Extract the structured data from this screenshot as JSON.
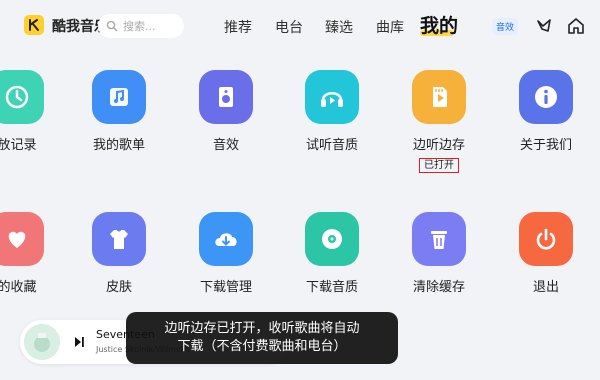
{
  "header": {
    "app_name": "酷我音乐",
    "search_placeholder": "搜索...",
    "nav": [
      "推荐",
      "电台",
      "臻选",
      "曲库"
    ],
    "active_nav": "我的",
    "sound_effect_label": "音效"
  },
  "grid": {
    "row1": [
      {
        "label": "放记录",
        "icon": "clock-icon",
        "color": "#3ed3b4"
      },
      {
        "label": "我的歌单",
        "icon": "music-note-icon",
        "color": "#3f8ff7"
      },
      {
        "label": "音效",
        "icon": "speaker-icon",
        "color": "#6b6ee9"
      },
      {
        "label": "试听音质",
        "icon": "headphones-icon",
        "color": "#22c6d8"
      },
      {
        "label": "边听边存",
        "icon": "sd-card-icon",
        "color": "#f5b13a",
        "status": "已打开"
      },
      {
        "label": "关于我们",
        "icon": "info-icon",
        "color": "#5b73e9"
      }
    ],
    "row2": [
      {
        "label": "的收藏",
        "icon": "heart-icon",
        "color": "#f07677"
      },
      {
        "label": "皮肤",
        "icon": "tshirt-icon",
        "color": "#6a7cf0"
      },
      {
        "label": "下载管理",
        "icon": "cloud-download-icon",
        "color": "#3d95f6"
      },
      {
        "label": "下载音质",
        "icon": "disc-icon",
        "color": "#2cc6a7"
      },
      {
        "label": "清除缓存",
        "icon": "trash-icon",
        "color": "#7a7ef2"
      },
      {
        "label": "退出",
        "icon": "power-icon",
        "color": "#f6683f"
      }
    ]
  },
  "player": {
    "song": "Seventeen",
    "artist": "Justice Skolnik/Wilmoth"
  },
  "toast": {
    "line1": "边听边存已打开，收听歌曲将自动",
    "line2": "下载（不含付费歌曲和电台）"
  }
}
